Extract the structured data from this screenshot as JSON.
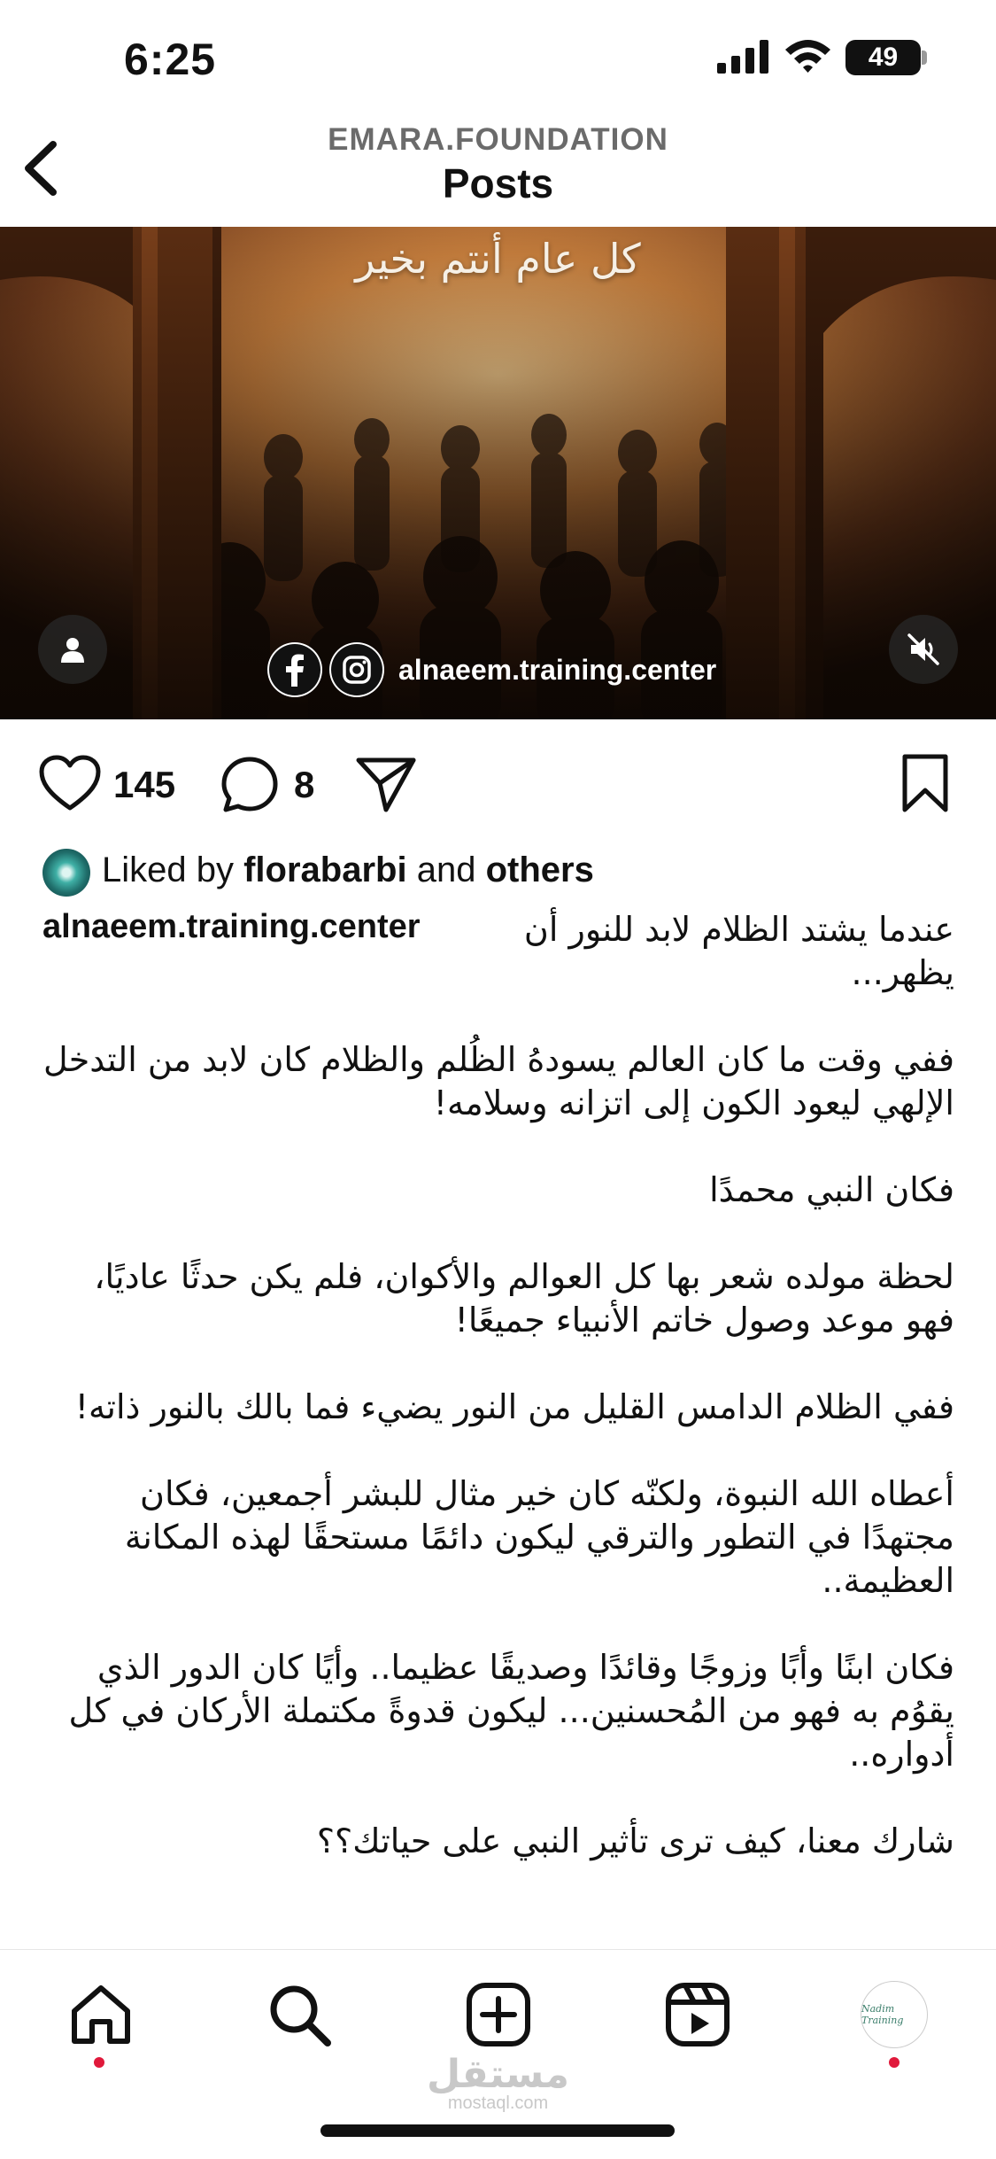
{
  "status_bar": {
    "time": "6:25",
    "battery": "49"
  },
  "header": {
    "account": "EMARA.FOUNDATION",
    "title": "Posts"
  },
  "post": {
    "media_overlay_text": "كل عام أنتم بخير",
    "media_handle": "alnaeem.training.center",
    "likes_count": "145",
    "comments_count": "8",
    "liked_by_prefix": "Liked by",
    "liked_by_user": "florabarbi",
    "liked_by_and": "and",
    "liked_by_others": "others",
    "caption_handle": "alnaeem.training.center",
    "caption_paragraphs": [
      "عندما يشتد الظلام لابد للنور أن يظهر...",
      "ففي وقت ما كان العالم يسودهُ الظُلم والظلام كان لابد من التدخل الإلهي ليعود الكون إلى اتزانه وسلامه!",
      "فكان النبي محمدًا",
      "لحظة مولده شعر بها كل العوالم والأكوان، فلم يكن حدثًا عاديًا، فهو موعد وصول خاتم الأنبياء جميعًا!",
      "ففي الظلام الدامس القليل من النور يضيء فما بالك بالنور ذاته!",
      "أعطاه الله النبوة، ولكنّه كان خير مثال للبشر أجمعين، فكان مجتهدًا في التطور والترقي ليكون دائمًا مستحقًا لهذه المكانة العظيمة..",
      "فكان ابنًا وأبًا وزوجًا وقائدًا وصديقًا عظيما.. وأيًا كان الدور الذي يقوُم به فهو من المُحسنين... ليكون قدوةً مكتملة الأركان في كل أدواره..",
      "شارك معنا، كيف ترى تأثير النبي على حياتك؟؟"
    ]
  },
  "profile_avatar_text": "Nadim Training",
  "watermark": {
    "arabic": "مستقل",
    "latin": "mostaql.com"
  },
  "icons": {
    "back": "chevron-left-icon",
    "heart": "heart-icon",
    "comment": "comment-icon",
    "share": "paper-plane-icon",
    "save": "bookmark-icon",
    "home": "home-icon",
    "search": "search-icon",
    "create": "plus-square-icon",
    "reels": "reels-icon",
    "mute": "speaker-muted-icon",
    "user_tag": "person-icon"
  },
  "colors": {
    "notification_dot": "#e0193b",
    "muted_text": "#6b6b6b"
  }
}
